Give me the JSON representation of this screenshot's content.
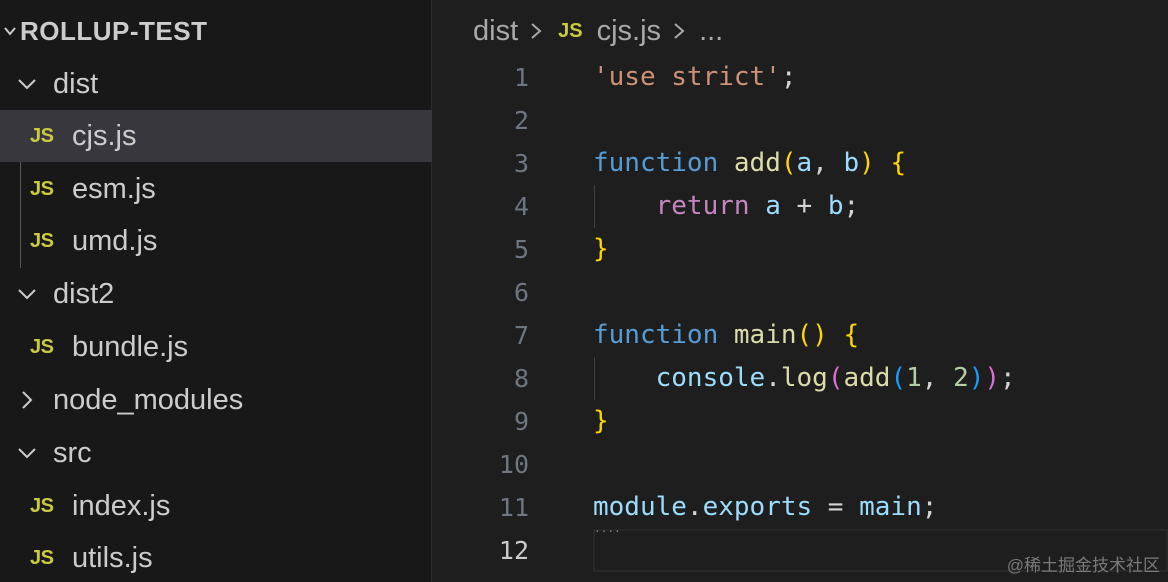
{
  "explorer": {
    "project_title": "ROLLUP-TEST",
    "items": [
      {
        "label": "dist",
        "kind": "folder",
        "state": "open"
      },
      {
        "label": "cjs.js",
        "kind": "file",
        "badge": "JS",
        "selected": true
      },
      {
        "label": "esm.js",
        "kind": "file",
        "badge": "JS"
      },
      {
        "label": "umd.js",
        "kind": "file",
        "badge": "JS"
      },
      {
        "label": "dist2",
        "kind": "folder",
        "state": "open"
      },
      {
        "label": "bundle.js",
        "kind": "file",
        "badge": "JS"
      },
      {
        "label": "node_modules",
        "kind": "folder",
        "state": "closed"
      },
      {
        "label": "src",
        "kind": "folder",
        "state": "open"
      },
      {
        "label": "index.js",
        "kind": "file",
        "badge": "JS"
      },
      {
        "label": "utils.js",
        "kind": "file",
        "badge": "JS"
      }
    ]
  },
  "breadcrumb": {
    "folder": "dist",
    "file_badge": "JS",
    "file": "cjs.js",
    "more": "..."
  },
  "editor": {
    "line_numbers": [
      "1",
      "2",
      "3",
      "4",
      "5",
      "6",
      "7",
      "8",
      "9",
      "10",
      "11",
      "12"
    ],
    "active_line": "12",
    "lines": [
      [
        "'use strict'",
        ";"
      ],
      [],
      [
        "function",
        " ",
        "add",
        "(",
        "a",
        ", ",
        "b",
        ")",
        " ",
        "{"
      ],
      [
        "    ",
        "return",
        " ",
        "a",
        " + ",
        "b",
        ";"
      ],
      [
        "}"
      ],
      [],
      [
        "function",
        " ",
        "main",
        "(",
        ")",
        " ",
        "{"
      ],
      [
        "    ",
        "console",
        ".",
        "log",
        "(",
        "add",
        "(",
        "1",
        ", ",
        "2",
        ")",
        ")",
        ";"
      ],
      [
        "}"
      ],
      [],
      [
        "module",
        ".",
        "exports",
        " = ",
        "main",
        ";"
      ],
      []
    ]
  },
  "watermark": "@稀土掘金技术社区",
  "colors": {
    "sidebar_bg": "#181818",
    "editor_bg": "#1e1e1e",
    "selected_row": "#37373d",
    "js_badge": "#cbcb41",
    "string": "#ce9178",
    "keyword": "#569cd6",
    "function": "#dcdcaa",
    "variable": "#9cdcfe",
    "control": "#c586c0",
    "number": "#b5cea8"
  }
}
